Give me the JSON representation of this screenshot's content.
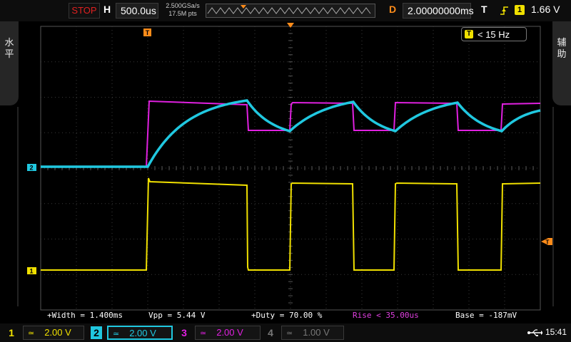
{
  "topbar": {
    "run_state": "STOP",
    "horizontal_label": "H",
    "timebase": "500.0us",
    "sample_rate": "2.500GSa/s",
    "memory_depth": "17.5M pts",
    "delay_label": "D",
    "delay_value": "2.00000000ms",
    "trigger_label": "T",
    "trigger_channel": "1",
    "trigger_level": "1.66 V"
  },
  "side": {
    "left_label": "水平",
    "right_label": "辅助"
  },
  "frequency_counter": {
    "marker": "T",
    "value": "< 15 Hz"
  },
  "markers": {
    "trigger_position": "T",
    "ch2_marker": "2",
    "ch1_marker": "1",
    "trigger_level_marker": "T"
  },
  "measurements": [
    {
      "label": "+Width = 1.400ms",
      "color": "#ffffff"
    },
    {
      "label": "Vpp = 5.44 V",
      "color": "#ffffff"
    },
    {
      "label": "+Duty = 70.00 %",
      "color": "#ffffff"
    },
    {
      "label": "Rise < 35.00us",
      "color": "#e040e0"
    },
    {
      "label": "Base = -187mV",
      "color": "#ffffff"
    }
  ],
  "channels": [
    {
      "num": "1",
      "coupling": "≃",
      "scale": "2.00 V",
      "color": "#f0e000"
    },
    {
      "num": "2",
      "coupling": "≃",
      "scale": "2.00 V",
      "color": "#20c8e0"
    },
    {
      "num": "3",
      "coupling": "≃",
      "scale": "2.00 V",
      "color": "#e020e0"
    },
    {
      "num": "4",
      "coupling": "≃",
      "scale": "1.00 V",
      "color": "#777777"
    }
  ],
  "status": {
    "time": "15:41"
  },
  "colors": {
    "ch1": "#f0e000",
    "ch2": "#20c8e0",
    "ch3": "#e020e0",
    "trigger": "#ff8c1a"
  },
  "waveform_data": {
    "time_per_div_us": 500,
    "volts_per_div": 2,
    "ch1_square": {
      "low_v": -0.19,
      "high_v": 5.25
    },
    "ch3_square": {
      "low_v": 1.3,
      "high_v": 3.9
    },
    "ch2_rc": {
      "low_v": 0,
      "peak_v": 3.8,
      "trough_v": 2.0
    }
  }
}
